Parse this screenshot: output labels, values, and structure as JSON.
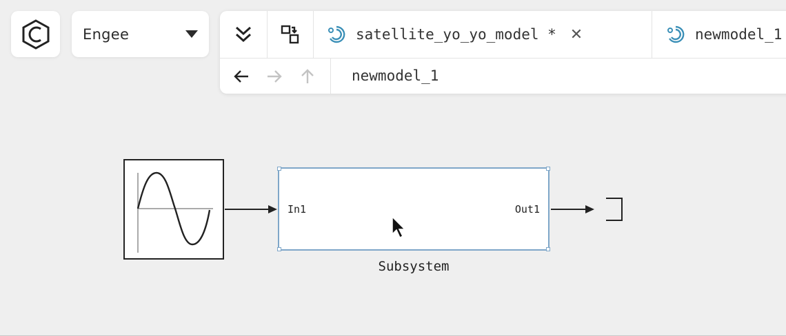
{
  "app": {
    "logo_icon": "engee-hexagon-logo",
    "workspace": {
      "label": "Engee",
      "icon": "caret-down-icon"
    }
  },
  "toolbar": {
    "collapse_icon": "double-chevron-down-icon",
    "switch_icon": "swap-windows-icon"
  },
  "tabs": [
    {
      "label": "satellite_yo_yo_model *",
      "icon": "model-icon",
      "active": true,
      "closable": true
    },
    {
      "label": "newmodel_1",
      "icon": "model-icon",
      "active": false,
      "closable": false
    }
  ],
  "path": {
    "back_icon": "arrow-left-icon",
    "forward_icon": "arrow-right-icon",
    "up_icon": "arrow-up-icon",
    "current": "newmodel_1"
  },
  "canvas": {
    "source_block": {
      "icon": "sine-wave-icon"
    },
    "subsystem": {
      "in_port": "In1",
      "out_port": "Out1",
      "caption": "Subsystem"
    },
    "output_block": {
      "icon": "terminator-icon"
    }
  },
  "colors": {
    "background": "#efefef",
    "selection": "#7ea6c8",
    "accent": "#3a8fb7"
  }
}
